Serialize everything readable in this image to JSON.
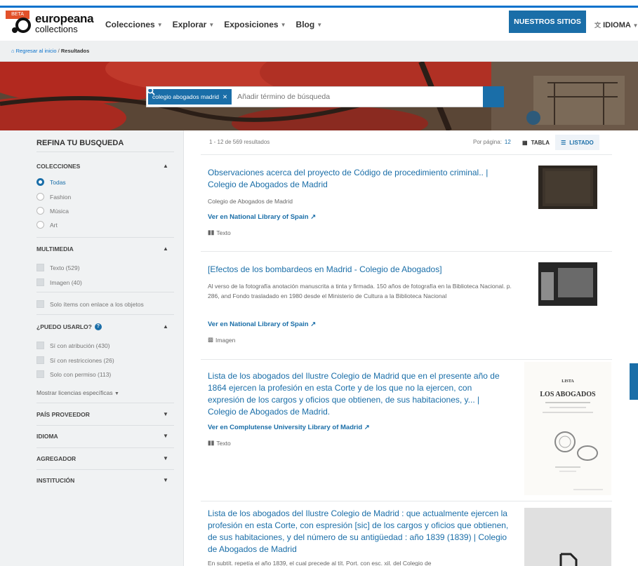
{
  "header": {
    "beta_badge": "BETA",
    "logo_name": "europeana",
    "logo_sub": "collections",
    "nav": [
      {
        "label": "Colecciones"
      },
      {
        "label": "Explorar"
      },
      {
        "label": "Exposiciones"
      },
      {
        "label": "Blog"
      }
    ],
    "nuestros_sitios": "NUESTROS SITIOS",
    "idioma": "IDIOMA"
  },
  "breadcrumb": {
    "home": "Regresar al inicio",
    "sep": "/",
    "current": "Resultados"
  },
  "search": {
    "pill": "colegio abogados madrid",
    "placeholder": "Añadir término de búsqueda"
  },
  "sidebar": {
    "title": "REFINA TU BUSQUEDA",
    "colecciones": {
      "title": "COLECCIONES",
      "options": [
        "Todas",
        "Fashion",
        "Música",
        "Art"
      ]
    },
    "multimedia": {
      "title": "MULTIMEDIA",
      "options": [
        "Texto (529)",
        "Imagen (40)"
      ],
      "linked": "Solo ítems con enlace a los objetos"
    },
    "usarlo": {
      "title": "¿PUEDO USARLO?",
      "options": [
        "Sí con atribución (430)",
        "Sí con restricciones (26)",
        "Solo con permiso (113)"
      ],
      "more": "Mostrar licencias específicas"
    },
    "collapsed": [
      "PAÍS PROVEEDOR",
      "IDIOMA",
      "AGREGADOR",
      "INSTITUCIÓN"
    ]
  },
  "results": {
    "count": "1 - 12 de 569 resultados",
    "per_page_label": "Por página:",
    "per_page_value": "12",
    "view_table": "TABLA",
    "view_list": "LISTADO",
    "items": [
      {
        "title": "Observaciones acerca del proyecto de Código de procedimiento criminal.. | Colegio de Abogados de Madrid",
        "desc": "Colegio de Abogados de Madrid",
        "link": "Ver en National Library of Spain",
        "type": "Texto"
      },
      {
        "title": "[Efectos de los bombardeos en Madrid - Colegio de Abogados]",
        "desc": "Al verso de la fotografía anotación manuscrita a tinta y firmada. 150 años de fotografía en la Biblioteca Nacional. p. 286, and Fondo trasladado en 1980 desde el Ministerio de Cultura a la Biblioteca Nacional",
        "link": "Ver en National Library of Spain",
        "type": "Imagen"
      },
      {
        "title": "Lista de los abogados del Ilustre Colegio de Madrid que en el presente año de 1864 ejercen la profesión en esta Corte y de los que no la ejercen, con expresión de los cargos y oficios que obtienen, de sus habitaciones, y... | Colegio de Abogados de Madrid.",
        "desc": "",
        "link": "Ver en Complutense University Library of Madrid",
        "type": "Texto",
        "thumb_lista": "LISTA",
        "thumb_title": "LOS ABOGADOS"
      },
      {
        "title": "Lista de los abogados del Ilustre Colegio de Madrid : que actualmente ejercen la profesión en esta Corte, con espresión [sic] de los cargos y oficios que obtienen, de sus habitaciones, y del número de su antigüedad : año 1839 (1839) | Colegio de Abogados de Madrid",
        "desc": "En subtít. repetía el año 1839, el cual precede al tít. Port. con esc. xil. del Colegio de"
      }
    ]
  },
  "colors": {
    "accent": "#1a6ea8",
    "top_bar": "#0a72cc",
    "beta": "#e2512a",
    "sidebar_bg": "#f0f2f3"
  }
}
